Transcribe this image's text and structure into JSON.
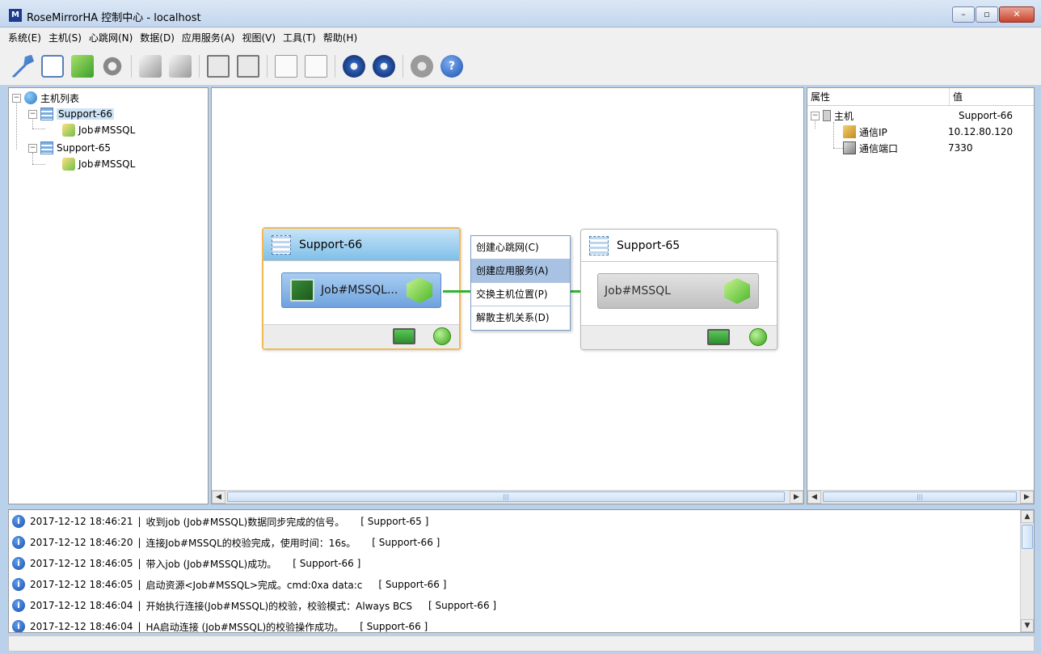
{
  "window": {
    "title": "RoseMirrorHA 控制中心  -  localhost",
    "controls": [
      "minimize",
      "maximize",
      "close"
    ]
  },
  "menu": [
    "系统(E)",
    "主机(S)",
    "心跳网(N)",
    "数据(D)",
    "应用服务(A)",
    "视图(V)",
    "工具(T)",
    "帮助(H)"
  ],
  "toolbar_icons": [
    "key-icon",
    "window-icon",
    "package-icon",
    "gear-icon",
    "cube-icon",
    "cube-icon",
    "monitor-icon",
    "monitor-icon",
    "document-icon",
    "document-icon",
    "gauge-icon",
    "gauge-icon",
    "disabled-icon",
    "help-icon"
  ],
  "host_tree": {
    "root_label": "主机列表",
    "hosts": [
      {
        "name": "Support-66",
        "job": "Job#MSSQL"
      },
      {
        "name": "Support-65",
        "job": "Job#MSSQL"
      }
    ]
  },
  "diagram": {
    "left_host": {
      "name": "Support-66",
      "job_label": "Job#MSSQL..."
    },
    "right_host": {
      "name": "Support-65",
      "job_label": "Job#MSSQL"
    }
  },
  "context_menu": [
    "创建心跳网(C)",
    "创建应用服务(A)",
    "交换主机位置(P)",
    "解散主机关系(D)"
  ],
  "properties": {
    "headers": {
      "name": "属性",
      "value": "值"
    },
    "group": {
      "label": "主机",
      "value": "Support-66"
    },
    "rows": [
      {
        "label": "通信IP",
        "value": "10.12.80.120"
      },
      {
        "label": "通信端口",
        "value": "7330"
      }
    ]
  },
  "log": [
    {
      "time": "2017-12-12 18:46:21",
      "message": "收到job (Job#MSSQL)数据同步完成的信号。",
      "host": "[ Support-65 ]"
    },
    {
      "time": "2017-12-12 18:46:20",
      "message": "连接Job#MSSQL的校验完成，使用时间：16s。",
      "host": "[ Support-66 ]"
    },
    {
      "time": "2017-12-12 18:46:05",
      "message": "带入job (Job#MSSQL)成功。",
      "host": "[ Support-66 ]"
    },
    {
      "time": "2017-12-12 18:46:05",
      "message": "启动资源<Job#MSSQL>完成。cmd:0xa data:c",
      "host": "[ Support-66 ]"
    },
    {
      "time": "2017-12-12 18:46:04",
      "message": "开始执行连接(Job#MSSQL)的校验，校验模式：Always BCS",
      "host": "[ Support-66 ]"
    },
    {
      "time": "2017-12-12 18:46:04",
      "message": "HA启动连接 (Job#MSSQL)的校验操作成功。",
      "host": "[ Support-66 ]"
    }
  ],
  "colors": {
    "accent": "#2fb52f",
    "selection": "#cde4f7",
    "active_card_border": "#f3b955"
  }
}
